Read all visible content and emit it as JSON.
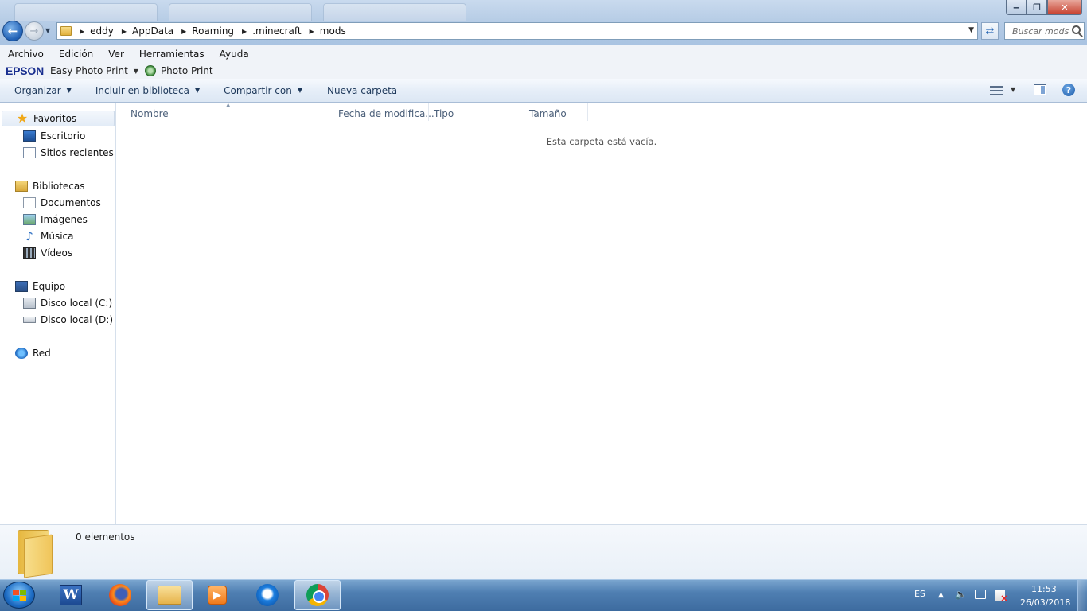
{
  "address_bar": {
    "breadcrumbs": [
      "eddy",
      "AppData",
      "Roaming",
      ".minecraft",
      "mods"
    ]
  },
  "search": {
    "placeholder": "Buscar mods"
  },
  "menu": {
    "items": [
      "Archivo",
      "Edición",
      "Ver",
      "Herramientas",
      "Ayuda"
    ]
  },
  "epson_toolbar": {
    "brand": "EPSON",
    "app": "Easy Photo Print",
    "photo_print": "Photo Print"
  },
  "command_bar": {
    "organize": "Organizar",
    "include_library": "Incluir en biblioteca",
    "share": "Compartir con",
    "new_folder": "Nueva carpeta"
  },
  "nav_pane": {
    "favorites": {
      "label": "Favoritos",
      "items": [
        "Escritorio",
        "Sitios recientes"
      ]
    },
    "libraries": {
      "label": "Bibliotecas",
      "items": [
        "Documentos",
        "Imágenes",
        "Música",
        "Vídeos"
      ]
    },
    "computer": {
      "label": "Equipo",
      "items": [
        "Disco local (C:)",
        "Disco local (D:)"
      ]
    },
    "network": {
      "label": "Red"
    }
  },
  "columns": [
    "Nombre",
    "Fecha de modifica...",
    "Tipo",
    "Tamaño"
  ],
  "empty_message": "Esta carpeta está vacía.",
  "details": {
    "count": "0 elementos"
  },
  "taskbar": {
    "pinned": [
      "word-icon",
      "firefox-icon",
      "explorer-icon",
      "media-player-icon",
      "bird-app-icon",
      "chrome-icon"
    ],
    "language": "ES",
    "time": "11:53",
    "date": "26/03/2018"
  },
  "colors": {
    "accent": "#1e395b",
    "taskbar": "#4f7fb2",
    "epson_brand": "#1a2f8f"
  }
}
